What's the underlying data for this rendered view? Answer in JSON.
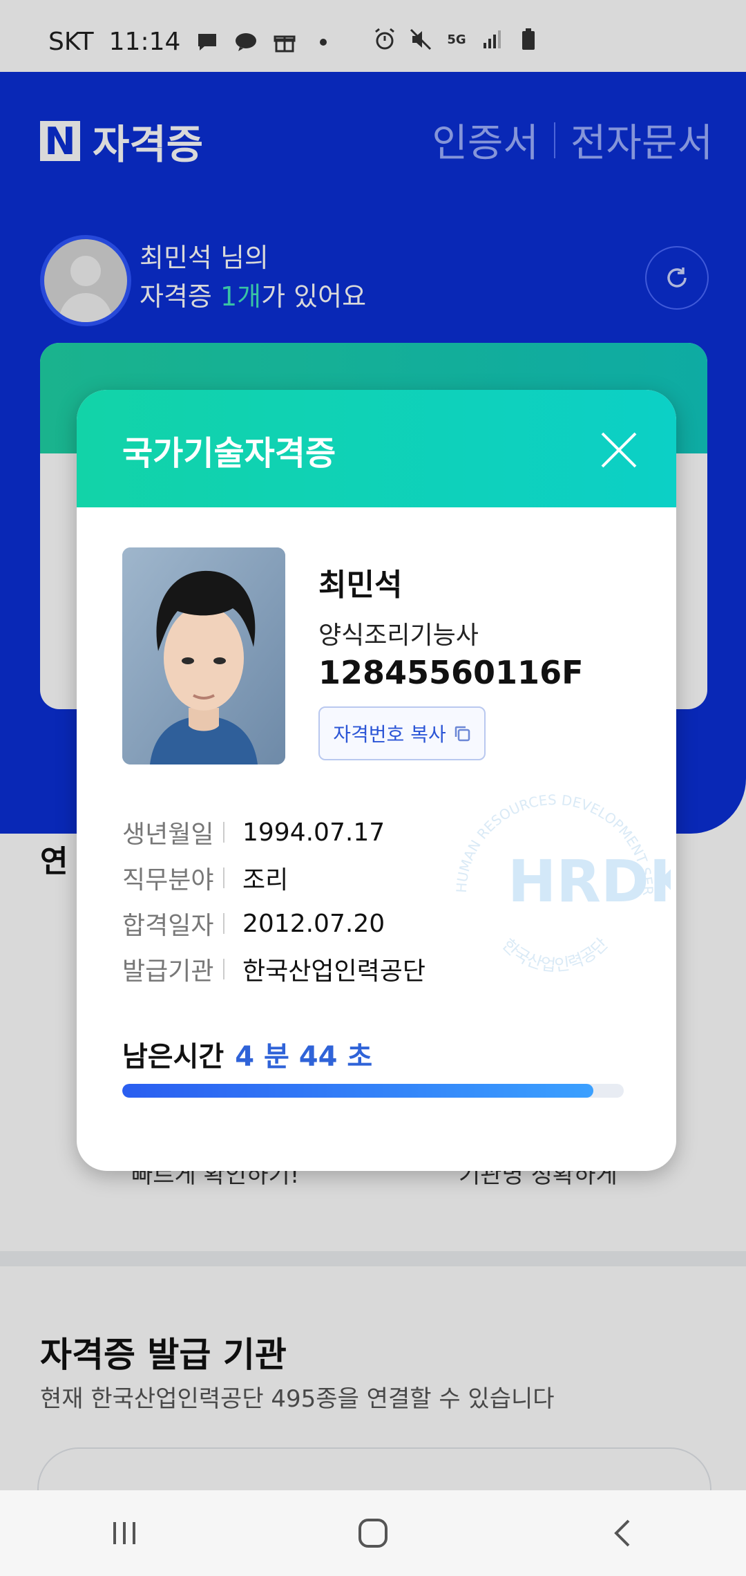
{
  "status_bar": {
    "carrier": "SKT",
    "time": "11:14",
    "network": "5G"
  },
  "header": {
    "logo_letter": "N",
    "title": "자격증",
    "tabs": [
      "인증서",
      "전자문서"
    ]
  },
  "greeting": {
    "line1": "최민석 님의",
    "line2_prefix": "자격증 ",
    "count": "1개",
    "line2_suffix": "가 있어요"
  },
  "background": {
    "section_peek": "연",
    "text_left": "빠르게 확인하기!",
    "text_right": "기관명 정확하게",
    "issuer_title": "자격증 발급 기관",
    "issuer_subtitle": "현재 한국산업인력공단 495종을 연결할 수 있습니다"
  },
  "modal": {
    "title": "국가기술자격증",
    "holder_name": "최민석",
    "certificate_name": "양식조리기능사",
    "certificate_number": "12845560116F",
    "copy_button": "자격번호 복사",
    "info": [
      {
        "label": "생년월일",
        "value": "1994.07.17"
      },
      {
        "label": "직무분야",
        "value": "조리"
      },
      {
        "label": "합격일자",
        "value": "2012.07.20"
      },
      {
        "label": "발급기관",
        "value": "한국산업인력공단"
      }
    ],
    "watermark_logo": "HRDK",
    "watermark_ring_en": "HUMAN RESOURCES DEVELOPMENT SERVICE OF KOREA",
    "watermark_ring_ko": "한국산업인력공단",
    "timer_label": "남은시간",
    "timer_minutes": "4",
    "timer_min_unit": "분",
    "timer_seconds": "44",
    "timer_sec_unit": "초",
    "remaining_fraction": 0.94
  },
  "colors": {
    "brand_blue": "#0b2fd6",
    "accent_teal": "#12d3a8",
    "timer_blue": "#2f63d8"
  }
}
